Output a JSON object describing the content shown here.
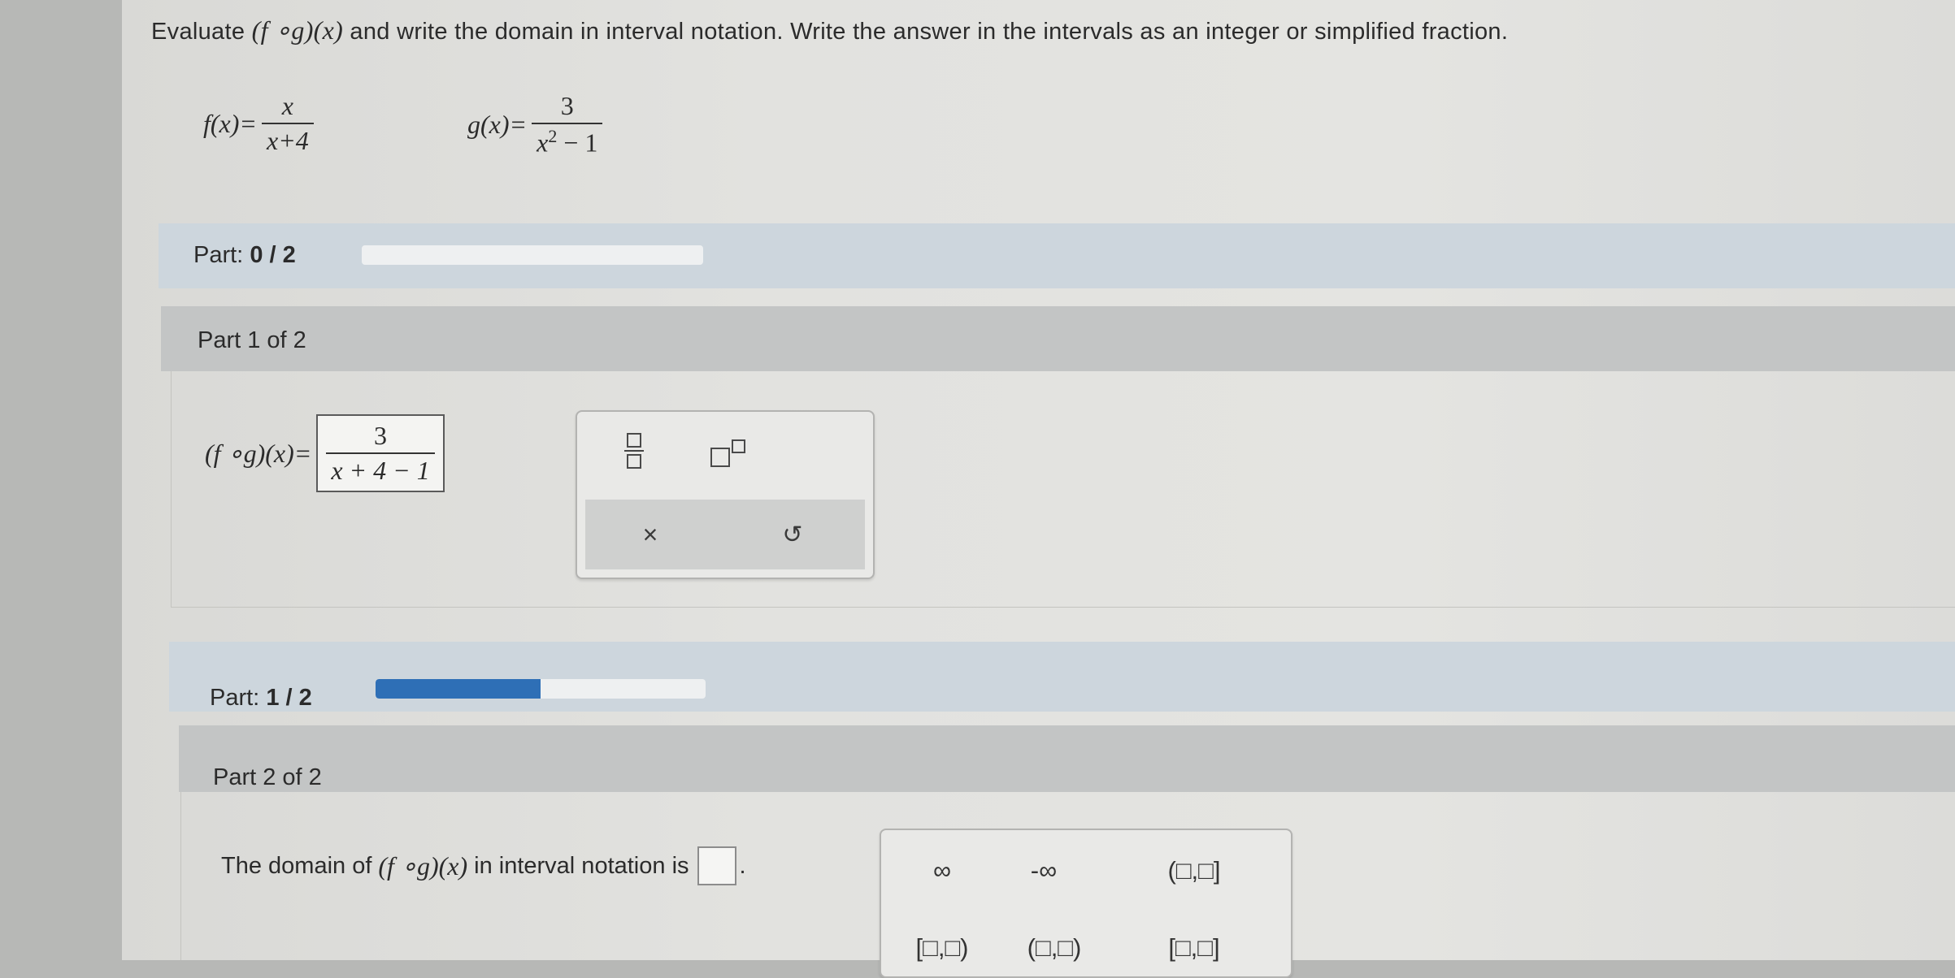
{
  "question": {
    "text_before": "Evaluate ",
    "composition": "(f ∘g)(x)",
    "text_after": " and write the domain in interval notation. Write the answer in the intervals as an integer or simplified fraction."
  },
  "functions": {
    "f_lhs": "f(x)=",
    "f_num": "x",
    "f_den": "x+4",
    "g_lhs": "g(x)=",
    "g_num": "3",
    "g_den_base": "x",
    "g_den_exp": "2",
    "g_den_rest": " − 1"
  },
  "progress_1": {
    "label": "Part: ",
    "value": "0 / 2",
    "fraction": 0.0
  },
  "part1": {
    "header": "Part 1 of 2",
    "lhs": "(f ∘g)(x)=",
    "answer_num": "3",
    "answer_den": "x + 4 − 1"
  },
  "palette1": {
    "fraction_icon": "fraction-template-icon",
    "exponent_icon": "exponent-template-icon",
    "clear_label": "×",
    "undo_label": "↺"
  },
  "progress_2": {
    "label": "Part: ",
    "value": "1 / 2",
    "fraction": 0.5
  },
  "part2": {
    "header": "Part 2 of 2",
    "text_before": "The domain of ",
    "composition": "(f ∘g)(x)",
    "text_after": " in interval notation is",
    "period": "."
  },
  "palette2": {
    "infinity": "∞",
    "neg_infinity": "-∞",
    "open_closed": "(□,□]",
    "closed_open": "[□,□)",
    "open_open": "(□,□)",
    "closed_closed": "[□,□]"
  }
}
